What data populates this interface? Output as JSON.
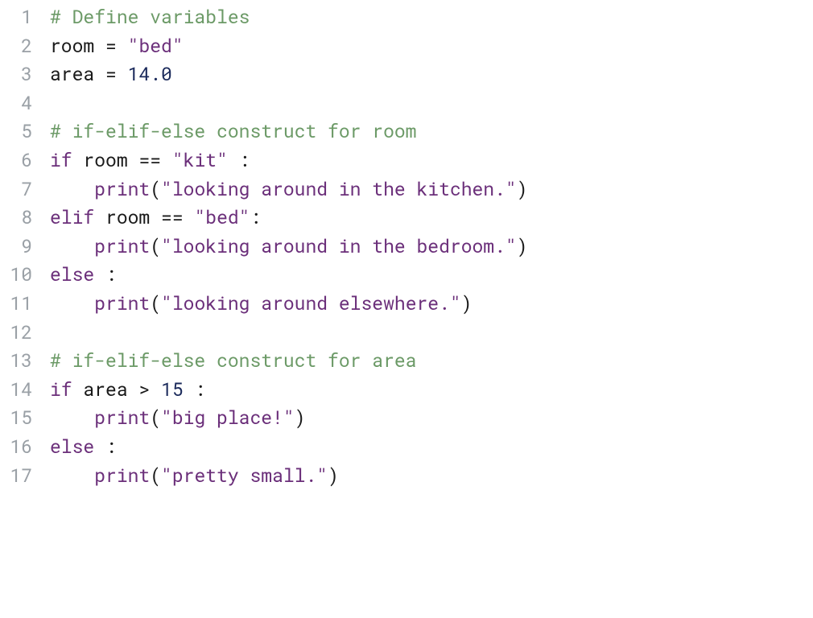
{
  "code": {
    "lines": [
      {
        "num": "1",
        "fold": false,
        "tokens": [
          {
            "cls": "tok-comment",
            "txt": "# Define variables"
          }
        ]
      },
      {
        "num": "2",
        "fold": false,
        "tokens": [
          {
            "cls": "tok-ident",
            "txt": "room"
          },
          {
            "cls": "tok-op",
            "txt": " = "
          },
          {
            "cls": "tok-string",
            "txt": "\"bed\""
          }
        ]
      },
      {
        "num": "3",
        "fold": false,
        "tokens": [
          {
            "cls": "tok-ident",
            "txt": "area"
          },
          {
            "cls": "tok-op",
            "txt": " = "
          },
          {
            "cls": "tok-number",
            "txt": "14.0"
          }
        ]
      },
      {
        "num": "4",
        "fold": false,
        "tokens": []
      },
      {
        "num": "5",
        "fold": false,
        "tokens": [
          {
            "cls": "tok-comment",
            "txt": "# if-elif-else construct for room"
          }
        ]
      },
      {
        "num": "6",
        "fold": true,
        "tokens": [
          {
            "cls": "tok-keyword",
            "txt": "if"
          },
          {
            "cls": "tok-ident",
            "txt": " room "
          },
          {
            "cls": "tok-op",
            "txt": "== "
          },
          {
            "cls": "tok-string",
            "txt": "\"kit\""
          },
          {
            "cls": "tok-colon",
            "txt": " :"
          }
        ]
      },
      {
        "num": "7",
        "fold": false,
        "tokens": [
          {
            "cls": "tok-ident",
            "txt": "    "
          },
          {
            "cls": "tok-builtin",
            "txt": "print"
          },
          {
            "cls": "tok-paren",
            "txt": "("
          },
          {
            "cls": "tok-string",
            "txt": "\"looking around in the kitchen.\""
          },
          {
            "cls": "tok-paren",
            "txt": ")"
          }
        ]
      },
      {
        "num": "8",
        "fold": true,
        "tokens": [
          {
            "cls": "tok-keyword",
            "txt": "elif"
          },
          {
            "cls": "tok-ident",
            "txt": " room "
          },
          {
            "cls": "tok-op",
            "txt": "== "
          },
          {
            "cls": "tok-string",
            "txt": "\"bed\""
          },
          {
            "cls": "tok-colon",
            "txt": ":"
          }
        ]
      },
      {
        "num": "9",
        "fold": false,
        "tokens": [
          {
            "cls": "tok-ident",
            "txt": "    "
          },
          {
            "cls": "tok-builtin",
            "txt": "print"
          },
          {
            "cls": "tok-paren",
            "txt": "("
          },
          {
            "cls": "tok-string",
            "txt": "\"looking around in the bedroom.\""
          },
          {
            "cls": "tok-paren",
            "txt": ")"
          }
        ]
      },
      {
        "num": "10",
        "fold": true,
        "tokens": [
          {
            "cls": "tok-keyword",
            "txt": "else"
          },
          {
            "cls": "tok-colon",
            "txt": " :"
          }
        ]
      },
      {
        "num": "11",
        "fold": false,
        "tokens": [
          {
            "cls": "tok-ident",
            "txt": "    "
          },
          {
            "cls": "tok-builtin",
            "txt": "print"
          },
          {
            "cls": "tok-paren",
            "txt": "("
          },
          {
            "cls": "tok-string",
            "txt": "\"looking around elsewhere.\""
          },
          {
            "cls": "tok-paren",
            "txt": ")"
          }
        ]
      },
      {
        "num": "12",
        "fold": false,
        "tokens": []
      },
      {
        "num": "13",
        "fold": false,
        "tokens": [
          {
            "cls": "tok-comment",
            "txt": "# if-elif-else construct for area"
          }
        ]
      },
      {
        "num": "14",
        "fold": true,
        "tokens": [
          {
            "cls": "tok-keyword",
            "txt": "if"
          },
          {
            "cls": "tok-ident",
            "txt": " area "
          },
          {
            "cls": "tok-op",
            "txt": "> "
          },
          {
            "cls": "tok-number",
            "txt": "15"
          },
          {
            "cls": "tok-colon",
            "txt": " :"
          }
        ]
      },
      {
        "num": "15",
        "fold": false,
        "tokens": [
          {
            "cls": "tok-ident",
            "txt": "    "
          },
          {
            "cls": "tok-builtin",
            "txt": "print"
          },
          {
            "cls": "tok-paren",
            "txt": "("
          },
          {
            "cls": "tok-string",
            "txt": "\"big place!\""
          },
          {
            "cls": "tok-paren",
            "txt": ")"
          }
        ]
      },
      {
        "num": "16",
        "fold": true,
        "tokens": [
          {
            "cls": "tok-keyword",
            "txt": "else"
          },
          {
            "cls": "tok-colon",
            "txt": " :"
          }
        ]
      },
      {
        "num": "17",
        "fold": false,
        "tokens": [
          {
            "cls": "tok-ident",
            "txt": "    "
          },
          {
            "cls": "tok-builtin",
            "txt": "print"
          },
          {
            "cls": "tok-paren",
            "txt": "("
          },
          {
            "cls": "tok-string",
            "txt": "\"pretty small.\""
          },
          {
            "cls": "tok-paren",
            "txt": ")"
          }
        ]
      }
    ]
  }
}
